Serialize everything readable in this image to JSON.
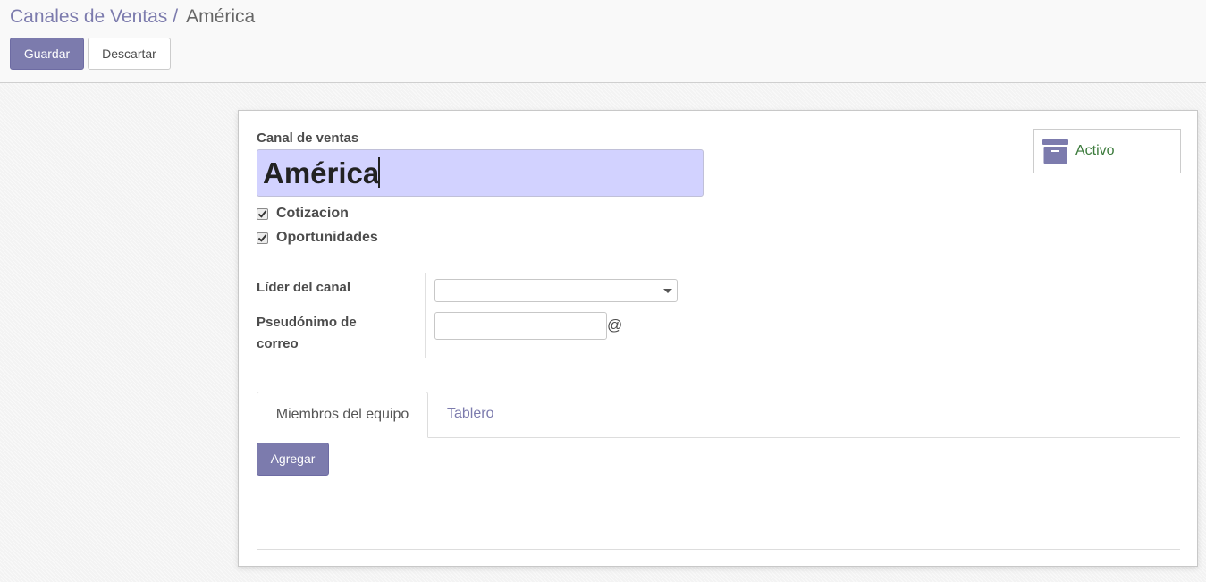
{
  "breadcrumb": {
    "parent": "Canales de Ventas",
    "separator": "/",
    "current": "América"
  },
  "toolbar": {
    "save_label": "Guardar",
    "discard_label": "Descartar"
  },
  "form": {
    "name_label": "Canal de ventas",
    "name_value": "América",
    "checkboxes": [
      {
        "label": "Cotizacion",
        "checked": true
      },
      {
        "label": "Oportunidades",
        "checked": true
      }
    ],
    "leader_label": "Líder del canal",
    "leader_value": "",
    "alias_label_line1": "Pseudónimo de",
    "alias_label_line2": "correo",
    "alias_value": "",
    "alias_suffix": "@",
    "active_button": {
      "label": "Activo",
      "icon": "archive-icon"
    },
    "tabs": [
      {
        "label": "Miembros del equipo",
        "active": true
      },
      {
        "label": "Tablero",
        "active": false
      }
    ],
    "add_label": "Agregar"
  },
  "colors": {
    "brand": "#7c7bad",
    "name_highlight": "#d2d2ff",
    "active_text": "#3b7a3b"
  }
}
